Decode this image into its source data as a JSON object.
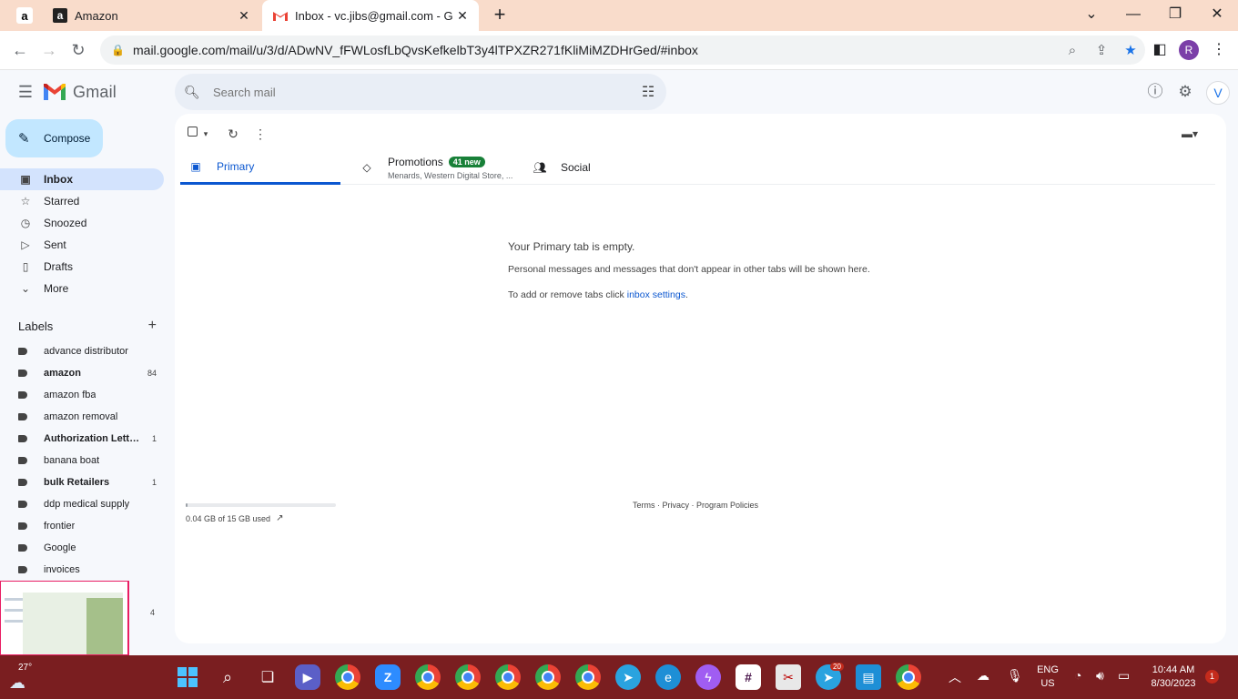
{
  "browser": {
    "tabs": [
      {
        "title": "Amazon",
        "favicon": "amazon-icon"
      },
      {
        "title": "Inbox - vc.jibs@gmail.com - Gma",
        "favicon": "gmail-icon",
        "active": true
      }
    ],
    "url": "mail.google.com/mail/u/3/d/ADwNV_fFWLosfLbQvsKefkelbT3y4lTPXZR271fKliMiMZDHrGed/#inbox",
    "profile_initial": "R"
  },
  "gmail": {
    "app_name": "Gmail",
    "search_placeholder": "Search mail",
    "account_initial": "V",
    "compose_label": "Compose",
    "nav": [
      {
        "label": "Inbox",
        "icon": "inbox-icon",
        "active": true
      },
      {
        "label": "Starred",
        "icon": "star-icon"
      },
      {
        "label": "Snoozed",
        "icon": "clock-icon"
      },
      {
        "label": "Sent",
        "icon": "send-icon"
      },
      {
        "label": "Drafts",
        "icon": "draft-icon"
      },
      {
        "label": "More",
        "icon": "chevron-down-icon"
      }
    ],
    "labels_heading": "Labels",
    "labels": [
      {
        "name": "advance distributor",
        "count": "",
        "bold": false
      },
      {
        "name": "amazon",
        "count": "84",
        "bold": true
      },
      {
        "name": "amazon fba",
        "count": "",
        "bold": false
      },
      {
        "name": "amazon removal",
        "count": "",
        "bold": false
      },
      {
        "name": "Authorization Lette...",
        "count": "1",
        "bold": true
      },
      {
        "name": "banana boat",
        "count": "",
        "bold": false
      },
      {
        "name": "bulk Retailers",
        "count": "1",
        "bold": true
      },
      {
        "name": "ddp medical supply",
        "count": "",
        "bold": false
      },
      {
        "name": "frontier",
        "count": "",
        "bold": false
      },
      {
        "name": "Google",
        "count": "",
        "bold": false
      },
      {
        "name": "invoices",
        "count": "",
        "bold": false
      }
    ],
    "hidden_label_count": "4",
    "category_tabs": {
      "primary": "Primary",
      "promotions": "Promotions",
      "promotions_badge": "41 new",
      "promotions_snippet": "Menards, Western Digital Store, ...",
      "social": "Social"
    },
    "empty_state": {
      "heading": "Your Primary tab is empty.",
      "body": "Personal messages and messages that don't appear in other tabs will be shown here.",
      "settings_prefix": "To add or remove tabs click ",
      "settings_link": "inbox settings",
      "settings_suffix": "."
    },
    "storage": {
      "text": "0.04 GB of 15 GB used",
      "fraction": 0.003
    },
    "footer": "Terms · Privacy · Program Policies"
  },
  "taskbar": {
    "temperature": "27°",
    "language_line1": "ENG",
    "language_line2": "US",
    "time": "10:44 AM",
    "date": "8/30/2023",
    "notification_count": "1",
    "telegram_badge": "20"
  }
}
